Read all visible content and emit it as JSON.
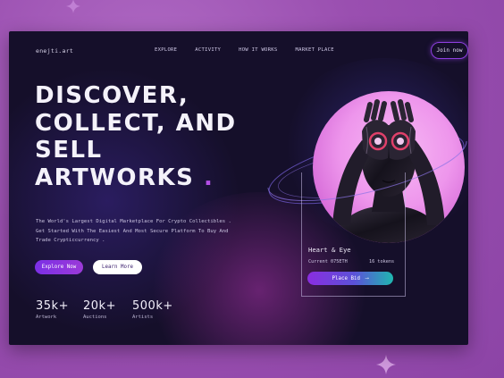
{
  "site": {
    "logo": "enejti.art"
  },
  "nav": {
    "items": [
      "EXPLORE",
      "ACTIVITY",
      "HOW IT WORKS",
      "MARKET PLACE"
    ],
    "join_label": "Join now"
  },
  "hero": {
    "headline_lines": [
      "DISCOVER,",
      "COLLECT, AND",
      "SELL",
      "ARTWORKS"
    ],
    "headline_dot": ".",
    "description": "The World's Largest Digital Marketplace For Crypto Collectibles . Get Started With The Easiest And Most Secure Platform To Buy And Trade Crypticcurrency .",
    "explore_label": "Explore Now",
    "learn_label": "Learn More"
  },
  "stats": [
    {
      "value": "35k+",
      "label": "Artwork"
    },
    {
      "value": "20k+",
      "label": "Auctions"
    },
    {
      "value": "500k+",
      "label": "Artists"
    }
  ],
  "card": {
    "title": "Heart & Eye",
    "current": "Current 075ETH",
    "tokens": "16 tokens",
    "bid_label": "Place Bid",
    "bid_arrow": "⟶"
  },
  "colors": {
    "accent": "#8e3fe0",
    "background": "#150f2a",
    "outer": "#9b52b0",
    "art": "#ee96ec"
  },
  "icons": [
    "sparkle-icon",
    "arrow-right-icon"
  ]
}
